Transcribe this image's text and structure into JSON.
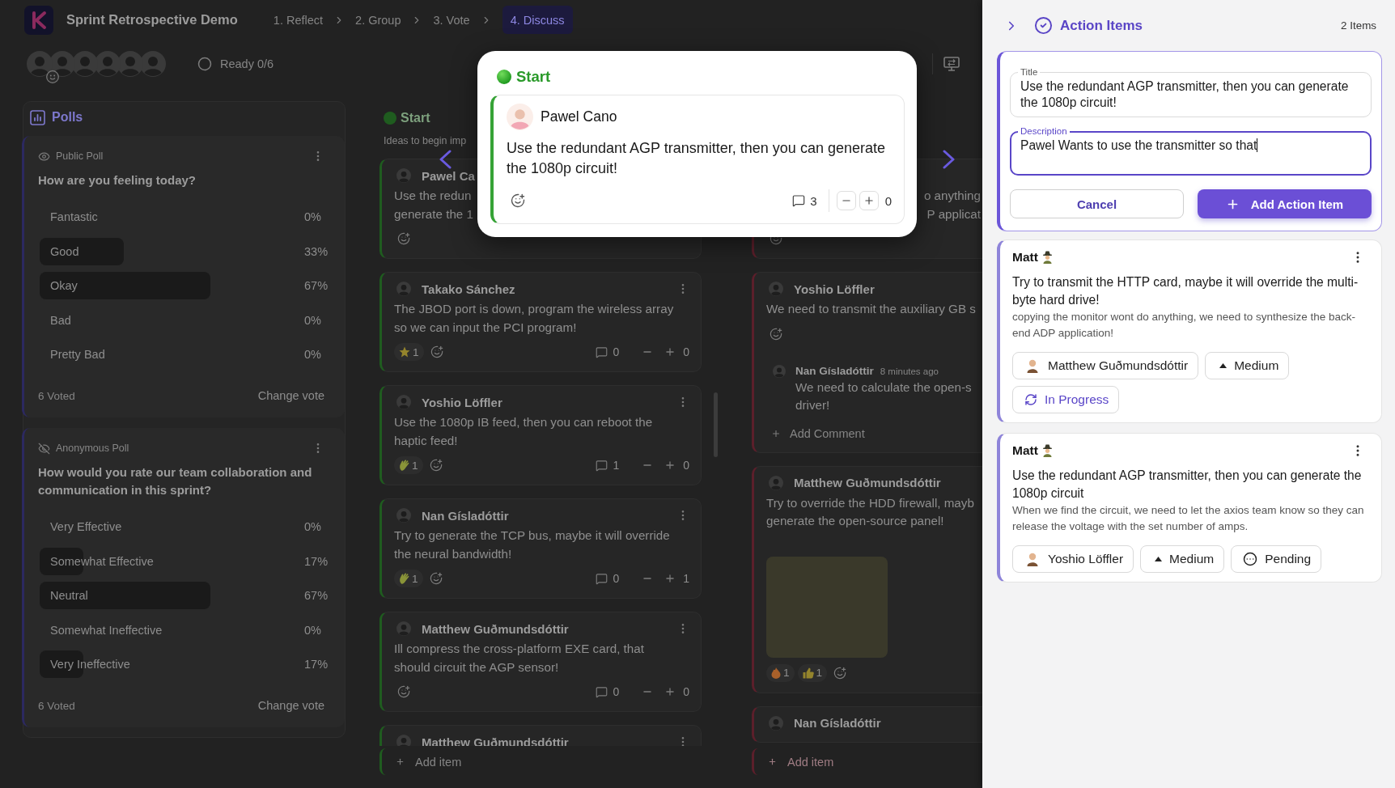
{
  "board": {
    "title": "Sprint Retrospective Demo",
    "steps": [
      {
        "label": "1. Reflect",
        "selected": false
      },
      {
        "label": "2. Group",
        "selected": false
      },
      {
        "label": "3. Vote",
        "selected": false
      },
      {
        "label": "4. Discuss",
        "selected": true
      }
    ],
    "participants": [
      {
        "emoji_badge": true
      },
      {
        "emoji_badge": false
      },
      {
        "emoji_badge": false
      },
      {
        "emoji_badge": false
      },
      {
        "emoji_badge": false
      },
      {
        "emoji_badge": false
      }
    ],
    "ready": "Ready 0/6"
  },
  "polls": {
    "title": "Polls",
    "items": [
      {
        "kind": "public",
        "type_label": "Public Poll",
        "question": "How are you feeling today?",
        "options": [
          {
            "label": "Fantastic",
            "percent": "0%"
          },
          {
            "label": "Good",
            "percent": "33%",
            "level": 0.33
          },
          {
            "label": "Okay",
            "percent": "67%",
            "level": 0.67
          },
          {
            "label": "Bad",
            "percent": "0%"
          },
          {
            "label": "Pretty Bad",
            "percent": "0%"
          }
        ],
        "votes": "6 Voted",
        "action": "Change vote"
      },
      {
        "kind": "anonymous",
        "type_label": "Anonymous Poll",
        "question": "How would you rate our team collaboration and communication in this sprint?",
        "options": [
          {
            "label": "Very Effective",
            "percent": "0%"
          },
          {
            "label": "Somewhat Effective",
            "percent": "17%",
            "level": 0.17
          },
          {
            "label": "Neutral",
            "percent": "67%",
            "level": 0.67
          },
          {
            "label": "Somewhat Ineffective",
            "percent": "0%"
          },
          {
            "label": "Very Ineffective",
            "percent": "17%",
            "level": 0.17
          }
        ],
        "votes": "6 Voted",
        "action": "Change vote"
      }
    ]
  },
  "columns": [
    {
      "title": "Start",
      "subtitle": "Ideas to begin imp",
      "color": "#1f5c1f",
      "cards": [
        {
          "kind": "full",
          "author": "Pawel Ca",
          "menu": false,
          "lines": [
            "Use the redun",
            "generate the 1"
          ],
          "add_reaction": true
        },
        {
          "kind": "full",
          "author": "Takako Sánchez",
          "menu": true,
          "lines": [
            "The JBOD port is down, program the wireless array",
            "so we can input the PCI program!"
          ],
          "reactions": [
            {
              "kind": "star",
              "count": "1"
            }
          ],
          "add_reaction": true,
          "comments": "0",
          "votes": "0"
        },
        {
          "kind": "full",
          "author": "Yoshio Löffler",
          "menu": true,
          "lines": [
            "Use the 1080p IB feed, then you can reboot the",
            "haptic feed!"
          ],
          "reactions": [
            {
              "kind": "clap",
              "count": "1"
            }
          ],
          "add_reaction": true,
          "comments": "1",
          "votes": "0"
        },
        {
          "kind": "full",
          "author": "Nan Gísladóttir",
          "menu": true,
          "lines": [
            "Try to generate the TCP bus, maybe it will override",
            "the neural bandwidth!"
          ],
          "reactions": [
            {
              "kind": "clap",
              "count": "1"
            }
          ],
          "add_reaction": true,
          "comments": "0",
          "votes": "1"
        },
        {
          "kind": "full",
          "author": "Matthew Guðmundsdóttir",
          "menu": true,
          "lines": [
            "Ill compress the cross-platform EXE card, that",
            "should circuit the AGP sensor!"
          ],
          "add_reaction": true,
          "comments": "0",
          "votes": "0"
        },
        {
          "kind": "full",
          "author": "Matthew Guðmundsdóttir",
          "menu": true
        }
      ],
      "add_item": {
        "label": "Add item",
        "highlighted": false
      }
    },
    {
      "color": "#5c1f2b",
      "cards": [
        {
          "kind": "tail",
          "lines": [
            "o anything",
            "P applicat"
          ],
          "add_reaction": true
        },
        {
          "kind": "full",
          "author": "Yoshio Löffler",
          "lines": [
            "We need to transmit the auxiliary GB s"
          ],
          "add_reaction": true,
          "thread": {
            "comments": [
              {
                "author": "Nan Gísladóttir",
                "time": "8 minutes ago",
                "lines": [
                  "We need to calculate the open-s",
                  "driver!"
                ]
              }
            ],
            "add_label": "Add Comment"
          }
        },
        {
          "kind": "full",
          "author": "Matthew Guðmundsdóttir",
          "lines": [
            "Try to override the HDD firewall, mayb",
            "generate the open-source panel!"
          ],
          "image": true,
          "reactions": [
            {
              "kind": "fire",
              "count": "1"
            },
            {
              "kind": "thumbs_up",
              "count": "1"
            }
          ],
          "add_reaction": true
        },
        {
          "kind": "full",
          "author": "Nan Gísladóttir"
        }
      ],
      "add_item": {
        "label": "Add item",
        "highlighted": true
      }
    }
  ],
  "modal": {
    "title": "Start",
    "author": "Pawel Cano",
    "text": "Use the redundant AGP transmitter, then you can generate the 1080p circuit!",
    "comments": "3",
    "votes": "0"
  },
  "action_panel": {
    "title": "Action Items",
    "count": "2 Items",
    "form": {
      "fields": [
        {
          "label": "Title",
          "value": "Use the redundant AGP transmitter, then you can generate the 1080p circuit!",
          "focused": false
        },
        {
          "label": "Description",
          "value": "Pawel Wants to use the transmitter so that",
          "focused": true
        }
      ],
      "cancel": "Cancel",
      "submit": "Add Action Item"
    },
    "items": [
      {
        "author": "Matt",
        "title": "Try to transmit the HTTP card, maybe it will override the multi-byte hard drive!",
        "description": "copying the monitor wont do anything, we need to synthesize the back-end ADP application!",
        "assignee": "Matthew Guðmundsdóttir",
        "priority": "Medium",
        "status": {
          "kind": "in_progress",
          "label": "In Progress"
        }
      },
      {
        "author": "Matt",
        "title": "Use the redundant AGP transmitter, then you can generate the 1080p circuit",
        "description": "When we find the circuit, we need to let the axios team know so they can release the voltage with the set number of amps.",
        "assignee": "Yoshio Löffler",
        "priority": "Medium",
        "status": {
          "kind": "pending",
          "label": "Pending"
        }
      }
    ]
  }
}
